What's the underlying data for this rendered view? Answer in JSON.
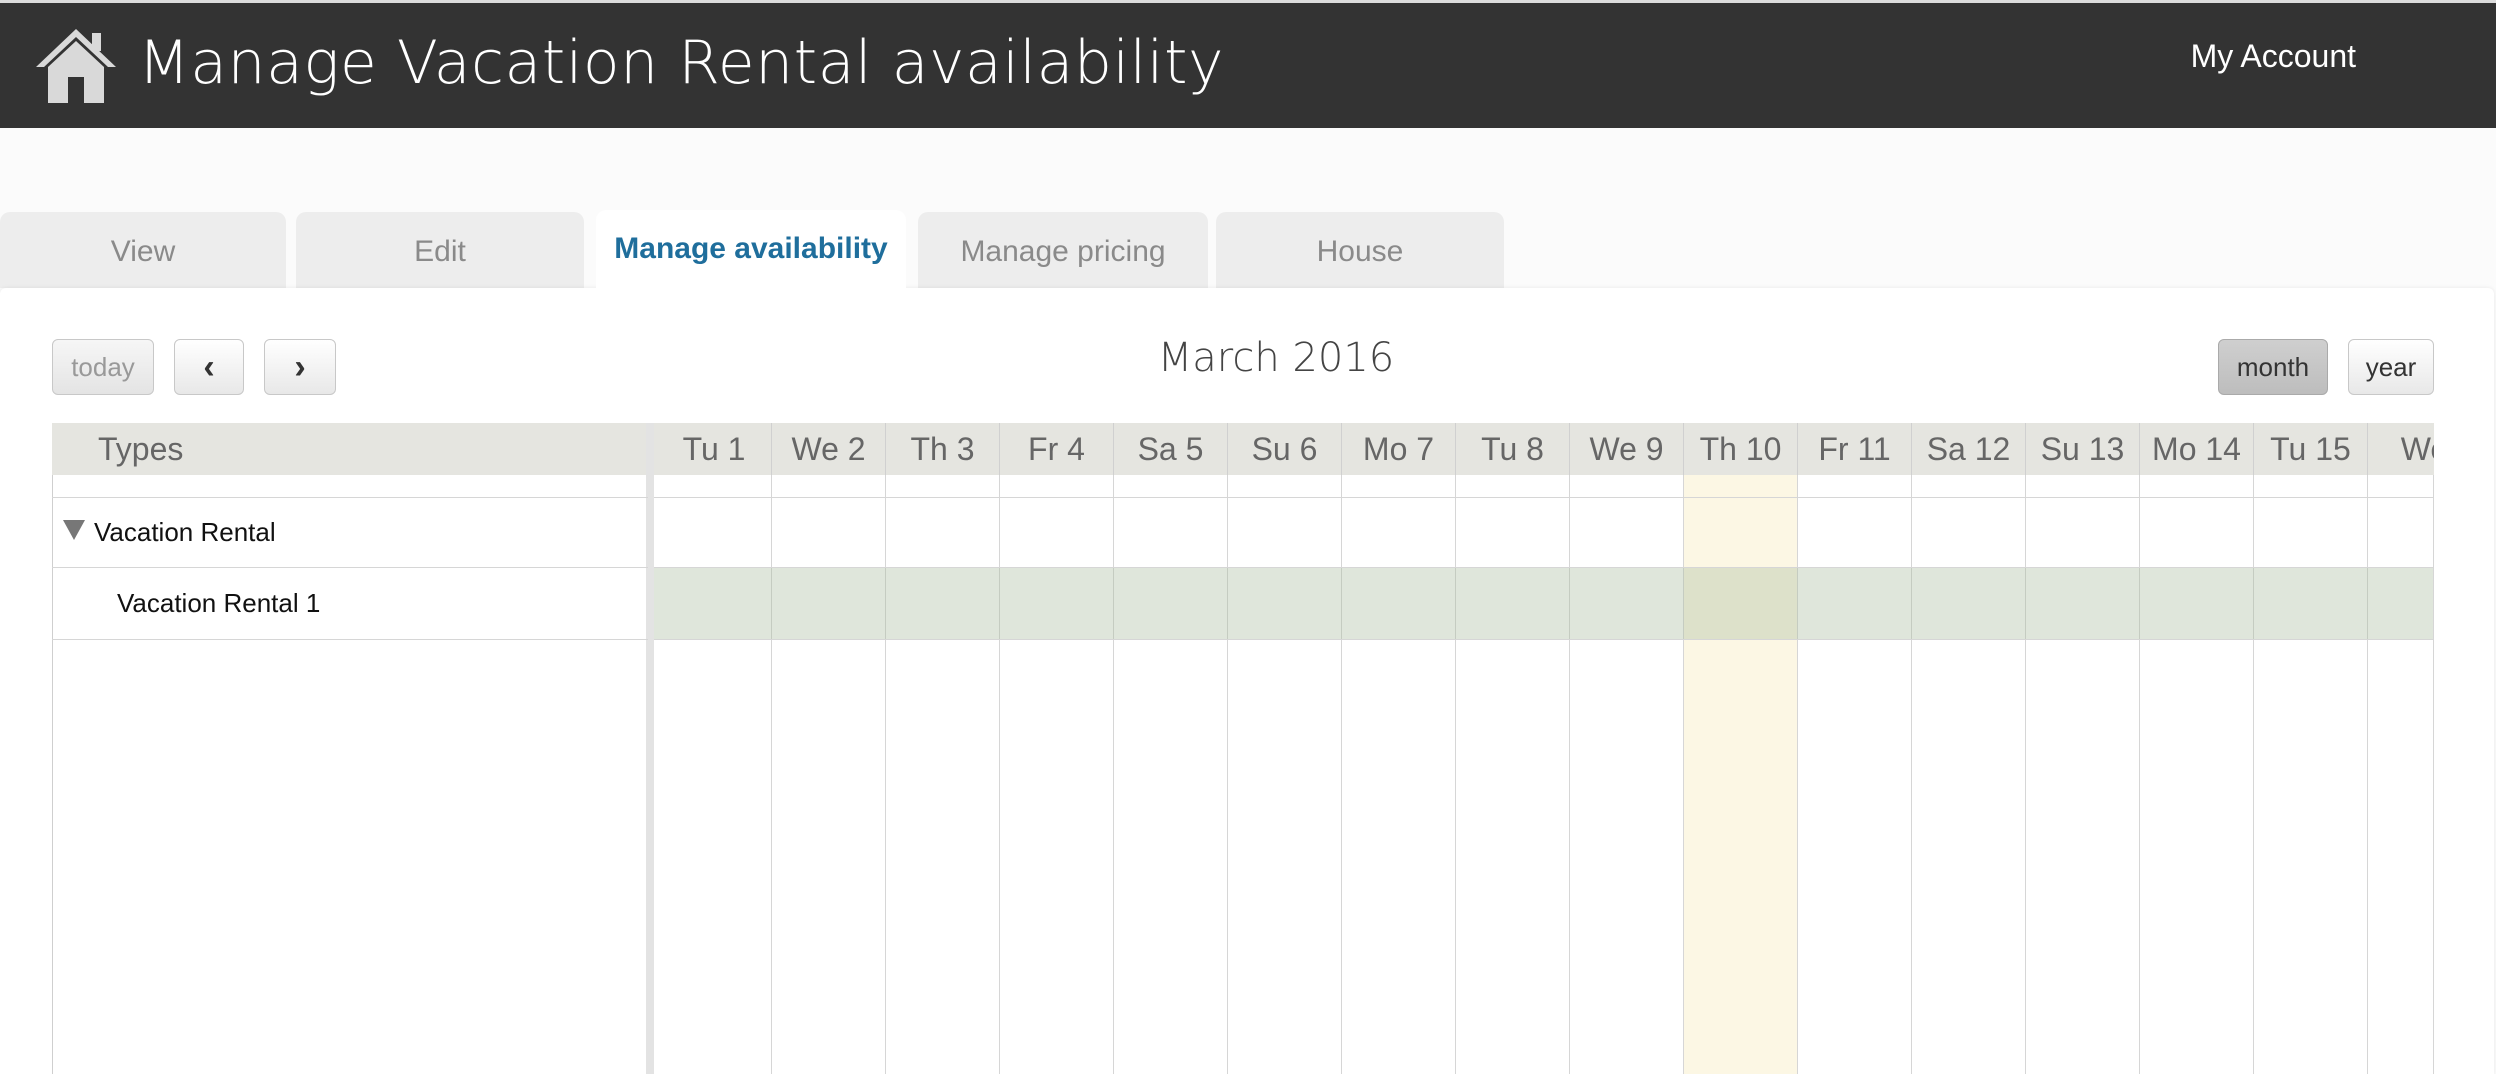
{
  "header": {
    "title": "Manage Vacation Rental availability",
    "account_label": "My Account",
    "icon": "home-icon",
    "background": "#333333"
  },
  "tabs": [
    {
      "label": "View",
      "active": false
    },
    {
      "label": "Edit",
      "active": false
    },
    {
      "label": "Manage availability",
      "active": true
    },
    {
      "label": "Manage pricing",
      "active": false
    },
    {
      "label": "House",
      "active": false
    }
  ],
  "toolbar": {
    "today_label": "today",
    "prev_label": "‹",
    "next_label": "›",
    "month_label": "month",
    "year_label": "year",
    "active_view": "month"
  },
  "calendar": {
    "title": "March 2016",
    "resource_header": "Types",
    "days": [
      "Tu 1",
      "We 2",
      "Th 3",
      "Fr 4",
      "Sa 5",
      "Su 6",
      "Mo 7",
      "Tu 8",
      "We 9",
      "Th 10",
      "Fr 11",
      "Sa 12",
      "Su 13",
      "Mo 14",
      "Tu 15",
      "We"
    ],
    "today_label": "Th 10",
    "today_color": "#fcf7e4",
    "availability_color": "#dde3d8"
  },
  "resources": {
    "group_label": "Vacation Rental",
    "group_expanded": true,
    "items": [
      {
        "label": "Vacation Rental 1"
      }
    ]
  },
  "accent_color": "#1f6e9c"
}
